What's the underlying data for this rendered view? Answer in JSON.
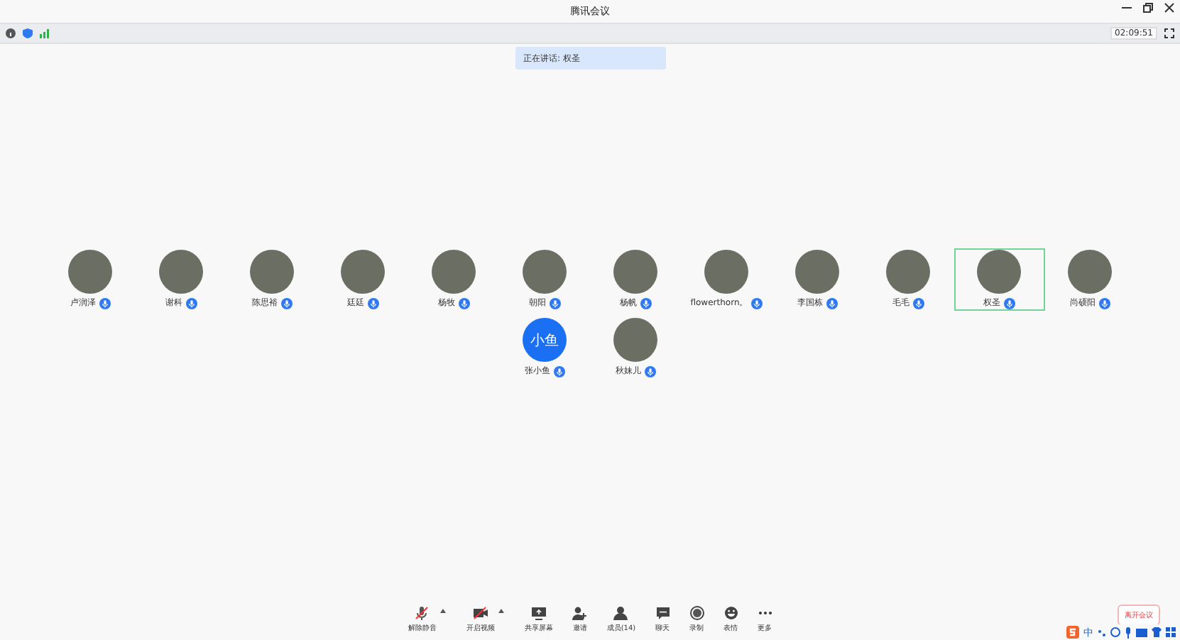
{
  "window": {
    "title": "腾讯会议"
  },
  "info_bar": {
    "timer": "02:09:51"
  },
  "speaking_banner": "正在讲话: 权圣",
  "participants": [
    {
      "name": "卢润泽",
      "kind": "photo",
      "selected": false
    },
    {
      "name": "谢科",
      "kind": "photo",
      "selected": false
    },
    {
      "name": "陈思裕",
      "kind": "photo",
      "selected": false
    },
    {
      "name": "廷廷",
      "kind": "photo",
      "selected": false
    },
    {
      "name": "杨牧",
      "kind": "photo",
      "selected": false
    },
    {
      "name": "朝阳",
      "kind": "photo",
      "selected": false
    },
    {
      "name": "杨帆",
      "kind": "photo",
      "selected": false
    },
    {
      "name": "flowerthorn。",
      "kind": "photo",
      "selected": false
    },
    {
      "name": "李国栋",
      "kind": "photo",
      "selected": false
    },
    {
      "name": "毛毛",
      "kind": "photo",
      "selected": false
    },
    {
      "name": "权圣",
      "kind": "photo",
      "selected": true
    },
    {
      "name": "尚硕阳",
      "kind": "photo",
      "selected": false
    },
    {
      "name": "张小鱼",
      "kind": "initials",
      "initials": "小鱼",
      "selected": false
    },
    {
      "name": "秋妹儿",
      "kind": "photo",
      "selected": false
    }
  ],
  "toolbar": [
    {
      "label": "解除静音",
      "kind": "mic",
      "caret": true
    },
    {
      "label": "开启视频",
      "kind": "video",
      "caret": true
    },
    {
      "label": "共享屏幕",
      "kind": "share",
      "caret": false
    },
    {
      "label": "邀请",
      "kind": "invite",
      "caret": false
    },
    {
      "label": "成员(14)",
      "kind": "members",
      "caret": false
    },
    {
      "label": "聊天",
      "kind": "chat",
      "caret": false
    },
    {
      "label": "录制",
      "kind": "record",
      "caret": false
    },
    {
      "label": "表情",
      "kind": "emoji",
      "caret": false
    },
    {
      "label": "更多",
      "kind": "more",
      "caret": false
    }
  ],
  "leave_button": "离开会议",
  "tray": {
    "ime_mode": "中"
  }
}
